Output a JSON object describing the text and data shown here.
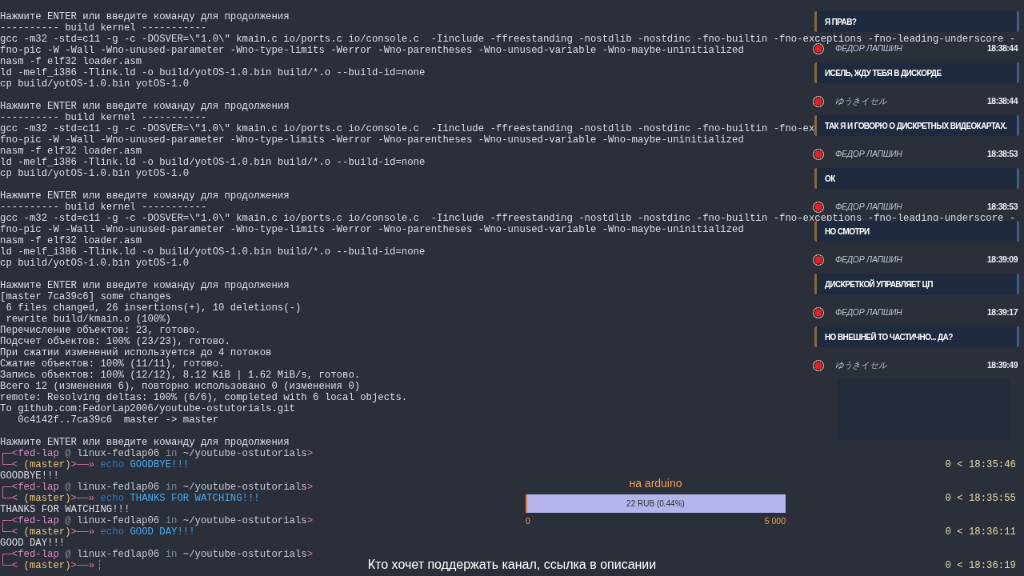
{
  "terminal": {
    "lines": [
      {
        "kind": "blank"
      },
      {
        "kind": "text",
        "text": "Нажмите ENTER или введите команду для продолжения"
      },
      {
        "kind": "text",
        "text": "---------- build kernel -----------"
      },
      {
        "kind": "text",
        "text": "gcc -m32 -std=c11 -g -c -DOSVER=\\\"1.0\\\" kmain.c io/ports.c io/console.c  -Iinclude -ffreestanding -nostdlib -nostdinc -fno-builtin -fno-exceptions -fno-leading-underscore -"
      },
      {
        "kind": "text",
        "text": "fno-pic -W -Wall -Wno-unused-parameter -Wno-type-limits -Werror -Wno-parentheses -Wno-unused-variable -Wno-maybe-uninitialized"
      },
      {
        "kind": "text",
        "text": "nasm -f elf32 loader.asm"
      },
      {
        "kind": "text",
        "text": "ld -melf_i386 -Tlink.ld -o build/yotOS-1.0.bin build/*.o --build-id=none"
      },
      {
        "kind": "text",
        "text": "cp build/yotOS-1.0.bin yotOS-1.0"
      },
      {
        "kind": "blank"
      },
      {
        "kind": "text",
        "text": "Нажмите ENTER или введите команду для продолжения"
      },
      {
        "kind": "text",
        "text": "---------- build kernel -----------"
      },
      {
        "kind": "text",
        "text": "gcc -m32 -std=c11 -g -c -DOSVER=\\\"1.0\\\" kmain.c io/ports.c io/console.c  -Iinclude -ffreestanding -nostdlib -nostdinc -fno-builtin -fno-ex"
      },
      {
        "kind": "text",
        "text": "fno-pic -W -Wall -Wno-unused-parameter -Wno-type-limits -Werror -Wno-parentheses -Wno-unused-variable -Wno-maybe-uninitialized"
      },
      {
        "kind": "text",
        "text": "nasm -f elf32 loader.asm"
      },
      {
        "kind": "text",
        "text": "ld -melf_i386 -Tlink.ld -o build/yotOS-1.0.bin build/*.o --build-id=none"
      },
      {
        "kind": "text",
        "text": "cp build/yotOS-1.0.bin yotOS-1.0"
      },
      {
        "kind": "blank"
      },
      {
        "kind": "text",
        "text": "Нажмите ENTER или введите команду для продолжения"
      },
      {
        "kind": "text",
        "text": "---------- build kernel -----------"
      },
      {
        "kind": "text",
        "text": "gcc -m32 -std=c11 -g -c -DOSVER=\\\"1.0\\\" kmain.c io/ports.c io/console.c  -Iinclude -ffreestanding -nostdlib -nostdinc -fno-builtin -fno-exceptions -fno-leading-underscore -"
      },
      {
        "kind": "text",
        "text": "fno-pic -W -Wall -Wno-unused-parameter -Wno-type-limits -Werror -Wno-parentheses -Wno-unused-variable -Wno-maybe-uninitialized"
      },
      {
        "kind": "text",
        "text": "nasm -f elf32 loader.asm"
      },
      {
        "kind": "text",
        "text": "ld -melf_i386 -Tlink.ld -o build/yotOS-1.0.bin build/*.o --build-id=none"
      },
      {
        "kind": "text",
        "text": "cp build/yotOS-1.0.bin yotOS-1.0"
      },
      {
        "kind": "blank"
      },
      {
        "kind": "text",
        "text": "Нажмите ENTER или введите команду для продолжения"
      },
      {
        "kind": "text",
        "text": "[master 7ca39c6] some changes"
      },
      {
        "kind": "text",
        "text": " 6 files changed, 26 insertions(+), 10 deletions(-)"
      },
      {
        "kind": "text",
        "text": " rewrite build/kmain.o (100%)"
      },
      {
        "kind": "text",
        "text": "Перечисление объектов: 23, готово."
      },
      {
        "kind": "text",
        "text": "Подсчет объектов: 100% (23/23), готово."
      },
      {
        "kind": "text",
        "text": "При сжатии изменений используется до 4 потоков"
      },
      {
        "kind": "text",
        "text": "Сжатие объектов: 100% (11/11), готово."
      },
      {
        "kind": "text",
        "text": "Запись объектов: 100% (12/12), 8.12 KiB | 1.62 MiB/s, готово."
      },
      {
        "kind": "text",
        "text": "Всего 12 (изменения 6), повторно использовано 0 (изменения 0)"
      },
      {
        "kind": "text",
        "text": "remote: Resolving deltas: 100% (6/6), completed with 6 local objects."
      },
      {
        "kind": "text",
        "text": "To github.com:FedorLap2006/youtube-ostutorials.git"
      },
      {
        "kind": "text",
        "text": "   0c4142f..7ca39c6  master -> master"
      },
      {
        "kind": "blank"
      },
      {
        "kind": "text",
        "text": "Нажмите ENTER или введите команду для продолжения"
      },
      {
        "kind": "prompt",
        "segments": [
          {
            "kind": "frame",
            "text": "┌─<"
          },
          {
            "kind": "user",
            "text": "fed-lap"
          },
          {
            "kind": "dim",
            "text": " @ "
          },
          {
            "kind": "host",
            "text": "linux-fedlap06"
          },
          {
            "kind": "dim",
            "text": " in "
          },
          {
            "kind": "path",
            "text": "~/youtube-ostutorials"
          },
          {
            "kind": "frame",
            "text": ">"
          }
        ]
      },
      {
        "kind": "prompt",
        "segments": [
          {
            "kind": "frame",
            "text": "└─< "
          },
          {
            "kind": "branch",
            "text": "(master)"
          },
          {
            "kind": "frame",
            "text": ">──»"
          },
          {
            "kind": "command",
            "text": " echo"
          },
          {
            "kind": "arg",
            "text": " GOODBYE!!!"
          }
        ],
        "time": "0 < 18:35:46"
      },
      {
        "kind": "text",
        "text": "GOODBYE!!!"
      },
      {
        "kind": "prompt",
        "segments": [
          {
            "kind": "frame",
            "text": "┌─<"
          },
          {
            "kind": "user",
            "text": "fed-lap"
          },
          {
            "kind": "dim",
            "text": " @ "
          },
          {
            "kind": "host",
            "text": "linux-fedlap06"
          },
          {
            "kind": "dim",
            "text": " in "
          },
          {
            "kind": "path",
            "text": "~/youtube-ostutorials"
          },
          {
            "kind": "frame",
            "text": ">"
          }
        ]
      },
      {
        "kind": "prompt",
        "segments": [
          {
            "kind": "frame",
            "text": "└─< "
          },
          {
            "kind": "branch",
            "text": "(master)"
          },
          {
            "kind": "frame",
            "text": ">──»"
          },
          {
            "kind": "command",
            "text": " echo"
          },
          {
            "kind": "arg",
            "text": " THANKS FOR WATCHING!!!"
          }
        ],
        "time": "0 < 18:35:55"
      },
      {
        "kind": "text",
        "text": "THANKS FOR WATCHING!!!"
      },
      {
        "kind": "prompt",
        "segments": [
          {
            "kind": "frame",
            "text": "┌─<"
          },
          {
            "kind": "user",
            "text": "fed-lap"
          },
          {
            "kind": "dim",
            "text": " @ "
          },
          {
            "kind": "host",
            "text": "linux-fedlap06"
          },
          {
            "kind": "dim",
            "text": " in "
          },
          {
            "kind": "path",
            "text": "~/youtube-ostutorials"
          },
          {
            "kind": "frame",
            "text": ">"
          }
        ]
      },
      {
        "kind": "prompt",
        "segments": [
          {
            "kind": "frame",
            "text": "└─< "
          },
          {
            "kind": "branch",
            "text": "(master)"
          },
          {
            "kind": "frame",
            "text": ">──»"
          },
          {
            "kind": "command",
            "text": " echo"
          },
          {
            "kind": "arg",
            "text": " GOOD DAY!!!"
          }
        ],
        "time": "0 < 18:36:11"
      },
      {
        "kind": "text",
        "text": "GOOD DAY!!!"
      },
      {
        "kind": "prompt",
        "segments": [
          {
            "kind": "frame",
            "text": "┌─<"
          },
          {
            "kind": "user",
            "text": "fed-lap"
          },
          {
            "kind": "dim",
            "text": " @ "
          },
          {
            "kind": "host",
            "text": "linux-fedlap06"
          },
          {
            "kind": "dim",
            "text": " in "
          },
          {
            "kind": "path",
            "text": "~/youtube-ostutorials"
          },
          {
            "kind": "frame",
            "text": ">"
          }
        ]
      },
      {
        "kind": "prompt",
        "segments": [
          {
            "kind": "frame",
            "text": "└─< "
          },
          {
            "kind": "branch",
            "text": "(master)"
          },
          {
            "kind": "frame",
            "text": ">──»"
          }
        ],
        "time": "0 < 18:36:19",
        "cursor": true
      }
    ]
  },
  "chat": {
    "messages": [
      {
        "text": "Я ПРАВ?"
      },
      {
        "author": "ФЕДОР ЛАПШИН",
        "time": "18:38:44",
        "text": "ИСЕЛЬ, ЖДУ ТЕБЯ В ДИСКОРДЕ"
      },
      {
        "author": "ゆうきイセル",
        "time": "18:38:44",
        "text": "ТАК Я И ГОВОРЮ О ДИСКРЕТНЫХ ВИДЕОКАРТАХ."
      },
      {
        "author": "ФЕДОР ЛАПШИН",
        "time": "18:38:53",
        "text": "ОК"
      },
      {
        "author": "ФЕДОР ЛАПШИН",
        "time": "18:38:53",
        "text": "НО СМОТРИ"
      },
      {
        "author": "ФЕДОР ЛАПШИН",
        "time": "18:39:09",
        "text": "ДИСКРЕТКОЙ УПРАВЛЯЕТ ЦП"
      },
      {
        "author": "ФЕДОР ЛАПШИН",
        "time": "18:39:17",
        "text": "НО ВНЕШНЕЙ ТО ЧАСТИЧНО... ДА?"
      },
      {
        "author": "ゆうきイセル",
        "time": "18:39:49"
      }
    ]
  },
  "donation": {
    "title": "на arduino",
    "label": "22 RUB (0.44%)",
    "level": 0.0044,
    "min": "0",
    "max": "5 000"
  },
  "caption": "Кто хочет поддержать канал, ссылка в описании"
}
